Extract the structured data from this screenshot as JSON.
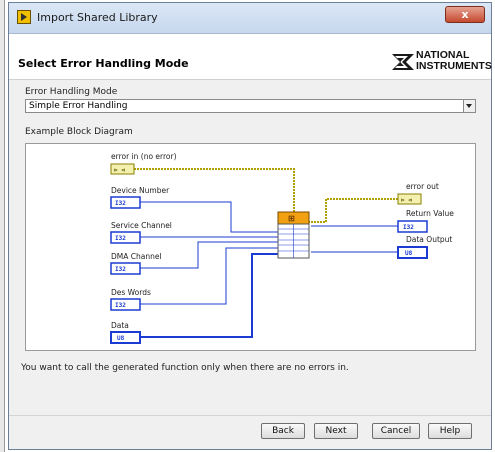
{
  "window": {
    "title": "Import Shared Library",
    "close_glyph": "x"
  },
  "header": {
    "title": "Select Error Handling Mode",
    "logo_line1": "NATIONAL",
    "logo_line2": "INSTRUMENTS"
  },
  "error_mode": {
    "label": "Error Handling Mode",
    "selected": "Simple Error Handling"
  },
  "diagram": {
    "label": "Example Block Diagram",
    "inputs": [
      {
        "name": "error in (no error)",
        "type": "error"
      },
      {
        "name": "Device Number",
        "type": "I32"
      },
      {
        "name": "Service Channel",
        "type": "I32"
      },
      {
        "name": "DMA Channel",
        "type": "I32"
      },
      {
        "name": "Des Words",
        "type": "I32"
      },
      {
        "name": "Data",
        "type": "U8"
      }
    ],
    "outputs": [
      {
        "name": "error out",
        "type": "error"
      },
      {
        "name": "Return Value",
        "type": "I32"
      },
      {
        "name": "Data Output",
        "type": "U8"
      }
    ],
    "colors": {
      "int_wire": "#1b3bd1",
      "u8_wire": "#1b3bd1",
      "error_wire": "#b0a000",
      "node_header": "#f0a010"
    },
    "error_terminal_text": "⊳ ⊲",
    "node_rows": [
      "I32",
      "I32",
      "I32",
      "I32",
      "I32",
      "U8"
    ]
  },
  "info": "You want to call the generated function only when there are no errors in.",
  "buttons": {
    "back": "Back",
    "next": "Next",
    "cancel": "Cancel",
    "help": "Help"
  }
}
